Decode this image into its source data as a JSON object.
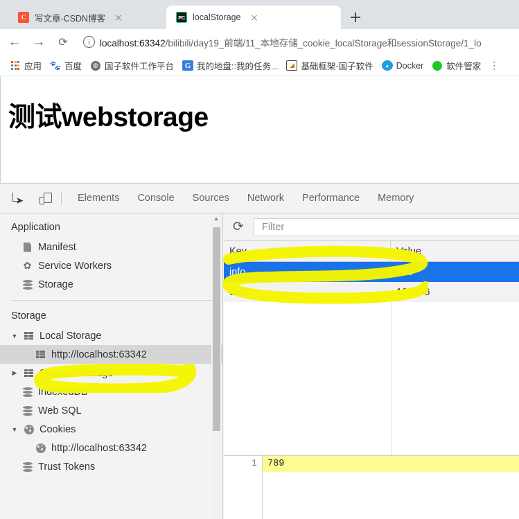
{
  "browser": {
    "tabs": [
      {
        "title": "写文章-CSDN博客",
        "favicon": "csdn-icon",
        "active": false
      },
      {
        "title": "localStorage",
        "favicon": "phpstorm-icon",
        "active": true
      }
    ],
    "new_tab_label": "+",
    "nav": {
      "back": "←",
      "forward": "→",
      "reload": "⟳",
      "site_info_icon": "info-circle-icon"
    },
    "url": {
      "host": "localhost:63342",
      "path": "/bilibili/day19_前端/11_本地存储_cookie_localStorage和sessionStorage/1_lo",
      "full": "localhost:63342/bilibili/day19_前端/11_本地存储_cookie_localStorage和sessionStorage/1_lo"
    },
    "bookmarks": [
      {
        "label": "应用",
        "icon": "apps-grid-icon"
      },
      {
        "label": "百度",
        "icon": "baidu-icon"
      },
      {
        "label": "国子软件工作平台",
        "icon": "globe-icon"
      },
      {
        "label": "我的地盘::我的任务...",
        "icon": "g-letter-icon"
      },
      {
        "label": "基础框架-国子软件",
        "icon": "framework-icon"
      },
      {
        "label": "Docker",
        "icon": "docker-whale-icon"
      },
      {
        "label": "软件管家",
        "icon": "wechat-icon"
      }
    ],
    "bookmarks_overflow": "⋮"
  },
  "page": {
    "heading": "测试webstorage"
  },
  "devtools": {
    "toolbar": {
      "inspect_icon": "inspect-element-icon",
      "device_icon": "device-toolbar-icon"
    },
    "tabs": [
      {
        "label": "Elements",
        "selected": false
      },
      {
        "label": "Console",
        "selected": false
      },
      {
        "label": "Sources",
        "selected": false
      },
      {
        "label": "Network",
        "selected": false
      },
      {
        "label": "Performance",
        "selected": false
      },
      {
        "label": "Memory",
        "selected": false
      }
    ],
    "sidebar": {
      "application_section": {
        "title": "Application",
        "items": [
          {
            "label": "Manifest",
            "icon": "document-icon"
          },
          {
            "label": "Service Workers",
            "icon": "gear-icon"
          },
          {
            "label": "Storage",
            "icon": "database-icon"
          }
        ]
      },
      "storage_section": {
        "title": "Storage",
        "items": [
          {
            "label": "Local Storage",
            "icon": "table-grid-icon",
            "twisty": "▼",
            "indent": 0,
            "selected": false
          },
          {
            "label": "http://localhost:63342",
            "icon": "table-grid-icon",
            "twisty": "",
            "indent": 1,
            "selected": true
          },
          {
            "label": "Session Storage",
            "icon": "table-grid-icon",
            "twisty": "▶",
            "indent": 0,
            "selected": false
          },
          {
            "label": "IndexedDB",
            "icon": "database-icon",
            "twisty": "",
            "indent": 0,
            "selected": false
          },
          {
            "label": "Web SQL",
            "icon": "database-icon",
            "twisty": "",
            "indent": 0,
            "selected": false
          },
          {
            "label": "Cookies",
            "icon": "cookie-icon",
            "twisty": "▼",
            "indent": 0,
            "selected": false
          },
          {
            "label": "http://localhost:63342",
            "icon": "cookie-icon",
            "twisty": "",
            "indent": 1,
            "selected": false
          },
          {
            "label": "Trust Tokens",
            "icon": "database-icon",
            "twisty": "",
            "indent": 0,
            "selected": false
          }
        ]
      }
    },
    "panel": {
      "refresh_icon": "refresh-icon",
      "filter_placeholder": "Filter",
      "filter_value": "",
      "columns": [
        "Key",
        "Value"
      ],
      "rows": [
        {
          "key": "info",
          "value": "789",
          "selected": true
        },
        {
          "key": "data",
          "value": "123456",
          "selected": false
        }
      ],
      "preview": {
        "line_number": "1",
        "content": "789"
      }
    }
  },
  "annotations": {
    "highlighter_color": "#f5f500",
    "selection_color": "#1a73e8",
    "overlap_color": "#1f6b0a",
    "marks": [
      {
        "name": "sidebar-origin-circle",
        "target": "http://localhost:63342"
      },
      {
        "name": "table-info-row-circle",
        "target": "info"
      }
    ]
  }
}
